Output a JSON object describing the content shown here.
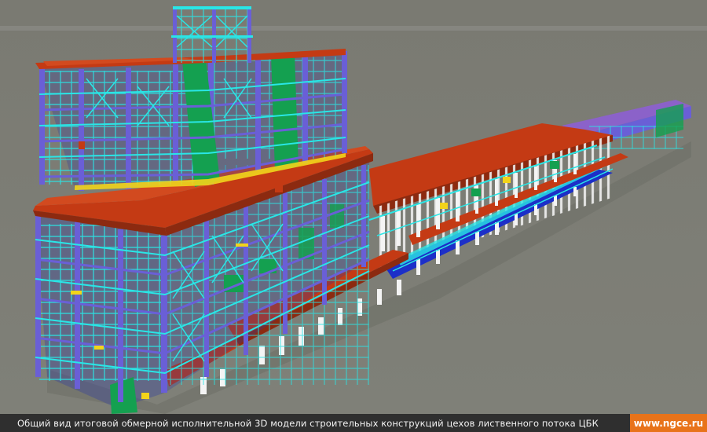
{
  "caption": "Общий вид итоговой обмерной исполнительной 3D модели строительных конструкций цехов лиственного потока ЦБК",
  "site": "www.ngce.ru",
  "colors": {
    "sky": "#7d7d75",
    "ground": "#76776f",
    "frame": "#6a5fd6",
    "beam": "#29e6e6",
    "roof": "#c43a14",
    "wall": "#14a050",
    "floor": "#1c2fc8",
    "column": "#f4f4f4",
    "yellow": "#f2d41a",
    "roofPurple": "#8b62c9",
    "badge": "#e8731a"
  }
}
